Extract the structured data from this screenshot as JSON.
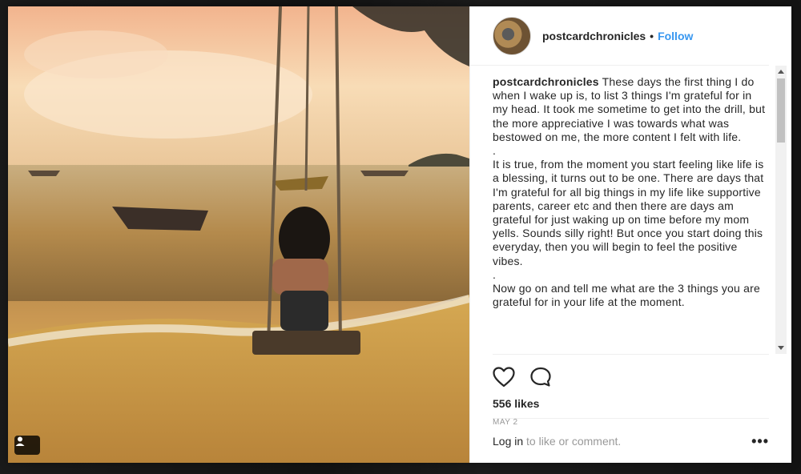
{
  "post": {
    "username": "postcardchronicles",
    "separator": "•",
    "follow_label": "Follow",
    "caption_author": "postcardchronicles",
    "caption_text": " These days the first thing I do when I wake up is, to list 3 things I'm grateful for in my head. It took me sometime to get into the drill, but the more appreciative I was towards what was bestowed on me, the more content I felt with life.\n.\nIt is true, from the moment you start feeling like life is a blessing, it turns out to be one. There are days that I'm grateful for all big things in my life like supportive parents, career etc and then there are days am grateful for just waking up on time before my mom yells. Sounds silly right! But once you start doing this everyday, then you will begin to feel the positive vibes.\n.\nNow go on and tell me what are the 3 things you are grateful for in your life at the moment.",
    "likes": "556 likes",
    "date": "MAY 2",
    "login_link": "Log in",
    "login_rest": " to like or comment.",
    "more_label": "•••"
  },
  "icons": {
    "like": "heart-icon",
    "comment": "comment-icon",
    "user_tag": "user-tag-icon"
  },
  "colors": {
    "accent": "#3897f0",
    "text": "#262626",
    "muted": "#999999"
  }
}
